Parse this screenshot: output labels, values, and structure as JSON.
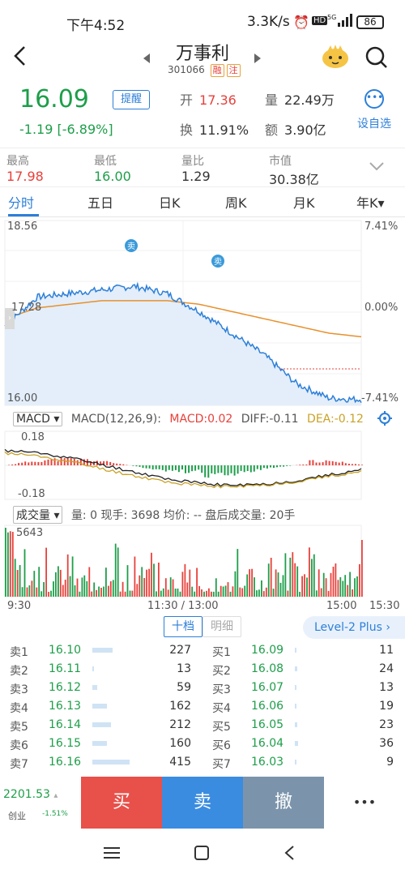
{
  "status_bar": {
    "time": "下午4:52",
    "network": "3.3K/s",
    "battery": "86"
  },
  "header": {
    "title": "万事利",
    "code": "301066",
    "tags": [
      "融",
      "注"
    ]
  },
  "quote": {
    "price": "16.09",
    "change": "-1.19",
    "change_pct": "[-6.89%]",
    "remind_label": "提醒",
    "open_label": "开",
    "open": "17.36",
    "volume_label": "量",
    "volume": "22.49万",
    "turnover_label": "换",
    "turnover": "11.91%",
    "amount_label": "额",
    "amount": "3.90亿",
    "favorite_label": "设自选"
  },
  "stats": [
    {
      "label": "最高",
      "value": "17.98",
      "color": "#e8413b"
    },
    {
      "label": "最低",
      "value": "16.00",
      "color": "#1e9e4a"
    },
    {
      "label": "量比",
      "value": "1.29",
      "color": "#333333"
    },
    {
      "label": "市值",
      "value": "30.38亿",
      "color": "#333333"
    }
  ],
  "tabs": [
    "分时",
    "五日",
    "日K",
    "周K",
    "月K",
    "年K▾"
  ],
  "chart": {
    "y_high": "18.56",
    "y_mid": "17.28",
    "y_low": "16.00",
    "pct_high": "7.41%",
    "pct_mid": "0.00%",
    "pct_low": "-7.41%",
    "sell_marker": "卖",
    "macd_selector": "MACD",
    "macd_params": "MACD(12,26,9):",
    "macd_value": "MACD:0.02",
    "diff_value": "DIFF:-0.11",
    "dea_value": "DEA:-0.12",
    "macd_high": "0.18",
    "macd_low": "-0.18",
    "vol_selector": "成交量",
    "vol_text": "量: 0   现手: 3698   均价: --   盘后成交量: 20手",
    "vol_max": "5643",
    "time_labels": [
      "9:30",
      "11:30 / 13:00",
      "15:00",
      "15:30"
    ],
    "colors": {
      "price": "#2d7fd8",
      "avg": "#e8902c",
      "up": "#e8413b",
      "down": "#1e9e4a"
    }
  },
  "chart_data": {
    "type": "line",
    "title": "",
    "ylim": [
      16.0,
      18.56
    ],
    "x": [
      "9:30",
      "11:30 / 13:00",
      "15:00"
    ],
    "series": [
      {
        "name": "",
        "values": [
          17.1,
          17.5,
          17.55,
          17.6,
          17.65,
          17.55,
          17.3,
          17.0,
          16.7,
          16.3,
          16.1,
          16.08
        ]
      },
      {
        "name": "",
        "values": [
          17.2,
          17.35,
          17.4,
          17.45,
          17.45,
          17.45,
          17.4,
          17.3,
          17.2,
          17.1,
          17.0,
          16.95
        ]
      }
    ]
  },
  "orderbook": {
    "tab_active": "十档",
    "tab_inactive": "明细",
    "level2": "Level-2 Plus ›",
    "sell": [
      {
        "label": "卖1",
        "price": "16.10",
        "vol": "227",
        "bar": 0.55
      },
      {
        "label": "卖2",
        "price": "16.11",
        "vol": "13",
        "bar": 0.03
      },
      {
        "label": "卖3",
        "price": "16.12",
        "vol": "59",
        "bar": 0.14
      },
      {
        "label": "卖4",
        "price": "16.13",
        "vol": "162",
        "bar": 0.39
      },
      {
        "label": "卖5",
        "price": "16.14",
        "vol": "212",
        "bar": 0.51
      },
      {
        "label": "卖6",
        "price": "16.15",
        "vol": "160",
        "bar": 0.39
      },
      {
        "label": "卖7",
        "price": "16.16",
        "vol": "415",
        "bar": 1.0
      }
    ],
    "buy": [
      {
        "label": "买1",
        "price": "16.09",
        "vol": "11",
        "bar": 0.03
      },
      {
        "label": "买2",
        "price": "16.08",
        "vol": "24",
        "bar": 0.06
      },
      {
        "label": "买3",
        "price": "16.07",
        "vol": "13",
        "bar": 0.03
      },
      {
        "label": "买4",
        "price": "16.06",
        "vol": "19",
        "bar": 0.05
      },
      {
        "label": "买5",
        "price": "16.05",
        "vol": "23",
        "bar": 0.06
      },
      {
        "label": "买6",
        "price": "16.04",
        "vol": "36",
        "bar": 0.09
      },
      {
        "label": "买7",
        "price": "16.03",
        "vol": "9",
        "bar": 0.02
      }
    ]
  },
  "bottom": {
    "index_value": "2201.53",
    "index_name": "创业",
    "index_change": "-1.51%",
    "buy_label": "买",
    "sell_label": "卖",
    "cancel_label": "撤",
    "more_label": "•••"
  }
}
